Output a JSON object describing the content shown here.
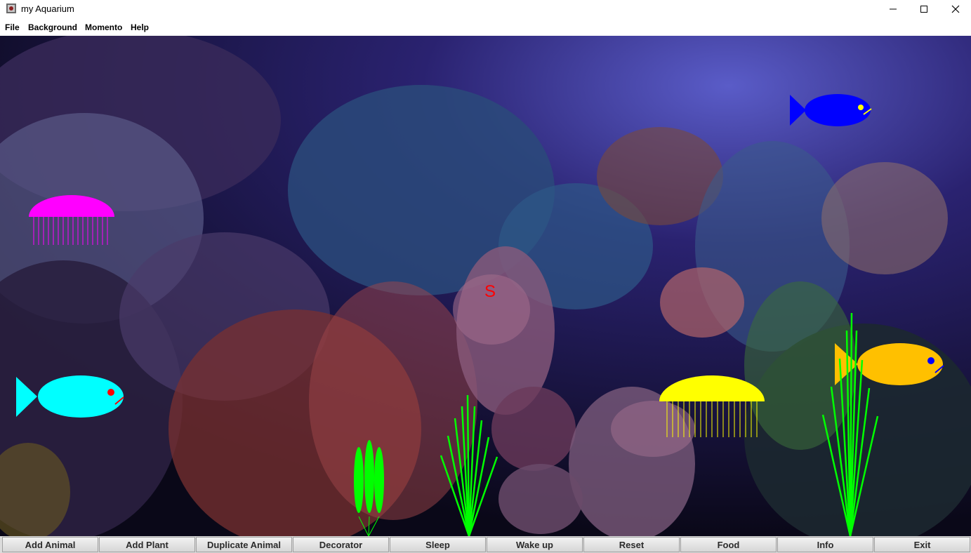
{
  "window": {
    "title": "my Aquarium",
    "icon": "aquarium-app-icon"
  },
  "menu": [
    "File",
    "Background",
    "Momento",
    "Help"
  ],
  "scene": {
    "food_marker": "S",
    "background": "coral-reef-image"
  },
  "buttons": [
    "Add Animal",
    "Add Plant",
    "Duplicate Animal",
    "Decorator",
    "Sleep",
    "Wake up",
    "Reset",
    "Food",
    "Info",
    "Exit"
  ],
  "colors": {
    "fish_blue": "#0000ff",
    "fish_cyan": "#00ffff",
    "fish_orange": "#ffc000",
    "jellyfish_magenta": "#ff00ff",
    "jellyfish_yellow": "#ffff00",
    "plant_green": "#00ff00",
    "food_red": "#ff0000"
  }
}
